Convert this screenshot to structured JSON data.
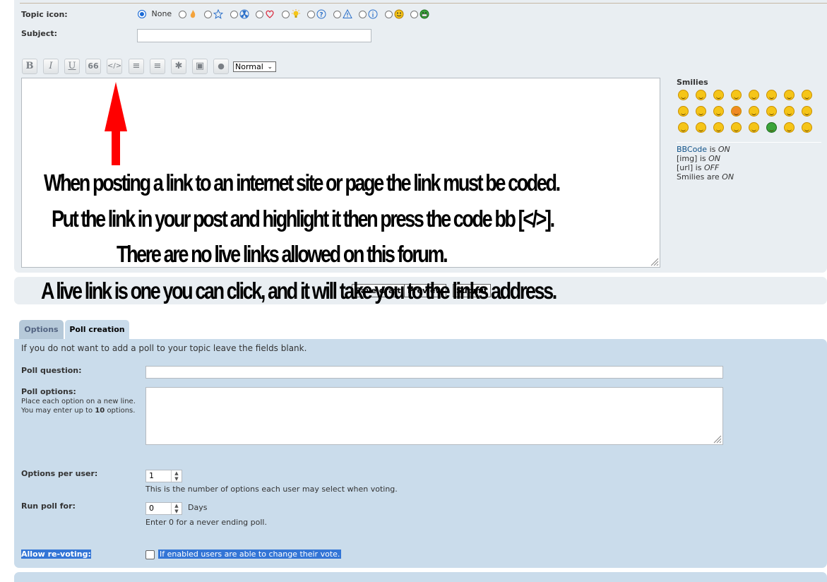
{
  "post_form": {
    "topic_icon_label": "Topic icon:",
    "none_label": "None",
    "subject_label": "Subject:",
    "subject_value": "",
    "font_size_value": "Normal",
    "icons": [
      "fire-icon",
      "star-icon",
      "radioactive-icon",
      "heart-icon",
      "lightbulb-icon",
      "question-icon",
      "warning-icon",
      "info-icon",
      "smiley-icon",
      "grin-icon"
    ],
    "toolbar": {
      "bold": "B",
      "italic": "I",
      "underline": "U",
      "quote": "66",
      "code": "</>",
      "list": "≡",
      "list_numbered": "≡",
      "list_item": "✱",
      "image": "▣",
      "color": "●"
    },
    "annotation": {
      "line1": "When posting a link to an internet site or page the link must be coded.",
      "line2": "Put the link in your post and highlight it then press the code bb [</>].",
      "line3": "There are no live links allowed on this forum.",
      "line4": "A live link is one you can click, and it will take you to the links address."
    },
    "smilies_title": "Smilies",
    "status": {
      "bbcode_link": "BBCode",
      "bbcode_state": "ON",
      "img_label": "[img]",
      "img_state": "ON",
      "url_label": "[url]",
      "url_state": "OFF",
      "smilies_label": "Smilies are",
      "smilies_state": "ON",
      "is_word": "is"
    },
    "buttons": {
      "save_draft": "Save draft",
      "preview": "Preview",
      "submit": "Submit"
    }
  },
  "tabs": [
    {
      "label": "Options"
    },
    {
      "label": "Poll creation"
    }
  ],
  "poll": {
    "intro": "If you do not want to add a poll to your topic leave the fields blank.",
    "question_label": "Poll question:",
    "options_label": "Poll options:",
    "options_explain_1": "Place each option on a new line. You may enter up to",
    "options_explain_max": "10",
    "options_explain_2": "options.",
    "per_user_label": "Options per user:",
    "per_user_value": "1",
    "per_user_explain": "This is the number of options each user may select when voting.",
    "run_for_label": "Run poll for:",
    "run_for_value": "0",
    "run_for_unit": "Days",
    "run_for_explain": "Enter 0 for a never ending poll.",
    "revote_label": "Allow re-voting:",
    "revote_explain": "If enabled users are able to change their vote."
  },
  "colors": {
    "annotation_arrow": "#ff0000",
    "panel": "#e9eef2",
    "poll_panel": "#cadceb",
    "link": "#105289",
    "selection": "#3375d6"
  }
}
